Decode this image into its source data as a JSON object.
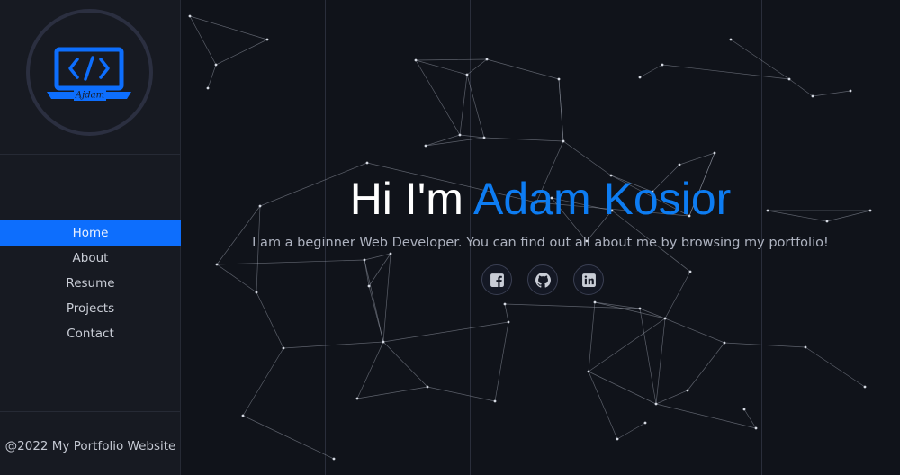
{
  "logo": {
    "icon": "laptop-code-icon",
    "signature": "Ajdam",
    "accent_color": "#0d6efd"
  },
  "nav": {
    "items": [
      {
        "label": "Home",
        "active": true
      },
      {
        "label": "About",
        "active": false
      },
      {
        "label": "Resume",
        "active": false
      },
      {
        "label": "Projects",
        "active": false
      },
      {
        "label": "Contact",
        "active": false
      }
    ]
  },
  "footer": {
    "text": "@2022 My Portfolio Website"
  },
  "hero": {
    "greeting": "Hi I'm",
    "name": "Adam Kosior",
    "subtitle": "I am a beginner Web Developer. You can find out all about me by browsing my portfolio!",
    "name_color": "#0d7cf2"
  },
  "social": [
    {
      "icon": "facebook-icon"
    },
    {
      "icon": "github-icon"
    },
    {
      "icon": "linkedin-icon"
    }
  ]
}
